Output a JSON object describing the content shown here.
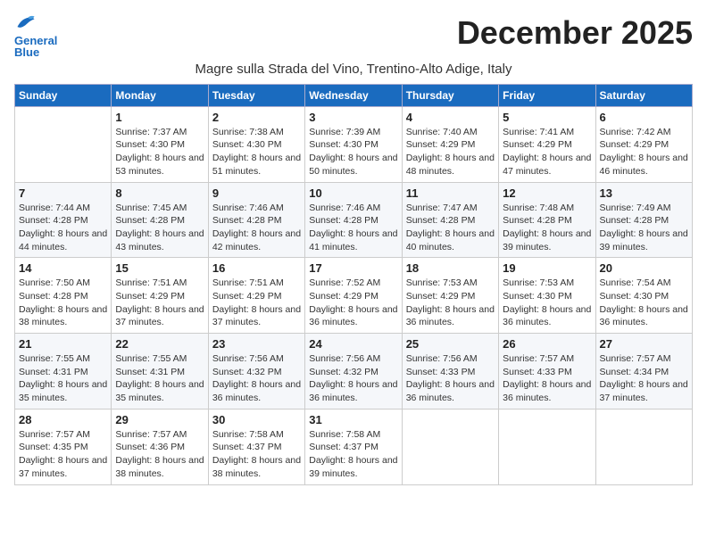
{
  "logo": {
    "line1": "General",
    "line2": "Blue"
  },
  "title": "December 2025",
  "subtitle": "Magre sulla Strada del Vino, Trentino-Alto Adige, Italy",
  "headers": [
    "Sunday",
    "Monday",
    "Tuesday",
    "Wednesday",
    "Thursday",
    "Friday",
    "Saturday"
  ],
  "weeks": [
    [
      {
        "day": "",
        "sunrise": "",
        "sunset": "",
        "daylight": ""
      },
      {
        "day": "1",
        "sunrise": "Sunrise: 7:37 AM",
        "sunset": "Sunset: 4:30 PM",
        "daylight": "Daylight: 8 hours and 53 minutes."
      },
      {
        "day": "2",
        "sunrise": "Sunrise: 7:38 AM",
        "sunset": "Sunset: 4:30 PM",
        "daylight": "Daylight: 8 hours and 51 minutes."
      },
      {
        "day": "3",
        "sunrise": "Sunrise: 7:39 AM",
        "sunset": "Sunset: 4:30 PM",
        "daylight": "Daylight: 8 hours and 50 minutes."
      },
      {
        "day": "4",
        "sunrise": "Sunrise: 7:40 AM",
        "sunset": "Sunset: 4:29 PM",
        "daylight": "Daylight: 8 hours and 48 minutes."
      },
      {
        "day": "5",
        "sunrise": "Sunrise: 7:41 AM",
        "sunset": "Sunset: 4:29 PM",
        "daylight": "Daylight: 8 hours and 47 minutes."
      },
      {
        "day": "6",
        "sunrise": "Sunrise: 7:42 AM",
        "sunset": "Sunset: 4:29 PM",
        "daylight": "Daylight: 8 hours and 46 minutes."
      }
    ],
    [
      {
        "day": "7",
        "sunrise": "Sunrise: 7:44 AM",
        "sunset": "Sunset: 4:28 PM",
        "daylight": "Daylight: 8 hours and 44 minutes."
      },
      {
        "day": "8",
        "sunrise": "Sunrise: 7:45 AM",
        "sunset": "Sunset: 4:28 PM",
        "daylight": "Daylight: 8 hours and 43 minutes."
      },
      {
        "day": "9",
        "sunrise": "Sunrise: 7:46 AM",
        "sunset": "Sunset: 4:28 PM",
        "daylight": "Daylight: 8 hours and 42 minutes."
      },
      {
        "day": "10",
        "sunrise": "Sunrise: 7:46 AM",
        "sunset": "Sunset: 4:28 PM",
        "daylight": "Daylight: 8 hours and 41 minutes."
      },
      {
        "day": "11",
        "sunrise": "Sunrise: 7:47 AM",
        "sunset": "Sunset: 4:28 PM",
        "daylight": "Daylight: 8 hours and 40 minutes."
      },
      {
        "day": "12",
        "sunrise": "Sunrise: 7:48 AM",
        "sunset": "Sunset: 4:28 PM",
        "daylight": "Daylight: 8 hours and 39 minutes."
      },
      {
        "day": "13",
        "sunrise": "Sunrise: 7:49 AM",
        "sunset": "Sunset: 4:28 PM",
        "daylight": "Daylight: 8 hours and 39 minutes."
      }
    ],
    [
      {
        "day": "14",
        "sunrise": "Sunrise: 7:50 AM",
        "sunset": "Sunset: 4:28 PM",
        "daylight": "Daylight: 8 hours and 38 minutes."
      },
      {
        "day": "15",
        "sunrise": "Sunrise: 7:51 AM",
        "sunset": "Sunset: 4:29 PM",
        "daylight": "Daylight: 8 hours and 37 minutes."
      },
      {
        "day": "16",
        "sunrise": "Sunrise: 7:51 AM",
        "sunset": "Sunset: 4:29 PM",
        "daylight": "Daylight: 8 hours and 37 minutes."
      },
      {
        "day": "17",
        "sunrise": "Sunrise: 7:52 AM",
        "sunset": "Sunset: 4:29 PM",
        "daylight": "Daylight: 8 hours and 36 minutes."
      },
      {
        "day": "18",
        "sunrise": "Sunrise: 7:53 AM",
        "sunset": "Sunset: 4:29 PM",
        "daylight": "Daylight: 8 hours and 36 minutes."
      },
      {
        "day": "19",
        "sunrise": "Sunrise: 7:53 AM",
        "sunset": "Sunset: 4:30 PM",
        "daylight": "Daylight: 8 hours and 36 minutes."
      },
      {
        "day": "20",
        "sunrise": "Sunrise: 7:54 AM",
        "sunset": "Sunset: 4:30 PM",
        "daylight": "Daylight: 8 hours and 36 minutes."
      }
    ],
    [
      {
        "day": "21",
        "sunrise": "Sunrise: 7:55 AM",
        "sunset": "Sunset: 4:31 PM",
        "daylight": "Daylight: 8 hours and 35 minutes."
      },
      {
        "day": "22",
        "sunrise": "Sunrise: 7:55 AM",
        "sunset": "Sunset: 4:31 PM",
        "daylight": "Daylight: 8 hours and 35 minutes."
      },
      {
        "day": "23",
        "sunrise": "Sunrise: 7:56 AM",
        "sunset": "Sunset: 4:32 PM",
        "daylight": "Daylight: 8 hours and 36 minutes."
      },
      {
        "day": "24",
        "sunrise": "Sunrise: 7:56 AM",
        "sunset": "Sunset: 4:32 PM",
        "daylight": "Daylight: 8 hours and 36 minutes."
      },
      {
        "day": "25",
        "sunrise": "Sunrise: 7:56 AM",
        "sunset": "Sunset: 4:33 PM",
        "daylight": "Daylight: 8 hours and 36 minutes."
      },
      {
        "day": "26",
        "sunrise": "Sunrise: 7:57 AM",
        "sunset": "Sunset: 4:33 PM",
        "daylight": "Daylight: 8 hours and 36 minutes."
      },
      {
        "day": "27",
        "sunrise": "Sunrise: 7:57 AM",
        "sunset": "Sunset: 4:34 PM",
        "daylight": "Daylight: 8 hours and 37 minutes."
      }
    ],
    [
      {
        "day": "28",
        "sunrise": "Sunrise: 7:57 AM",
        "sunset": "Sunset: 4:35 PM",
        "daylight": "Daylight: 8 hours and 37 minutes."
      },
      {
        "day": "29",
        "sunrise": "Sunrise: 7:57 AM",
        "sunset": "Sunset: 4:36 PM",
        "daylight": "Daylight: 8 hours and 38 minutes."
      },
      {
        "day": "30",
        "sunrise": "Sunrise: 7:58 AM",
        "sunset": "Sunset: 4:37 PM",
        "daylight": "Daylight: 8 hours and 38 minutes."
      },
      {
        "day": "31",
        "sunrise": "Sunrise: 7:58 AM",
        "sunset": "Sunset: 4:37 PM",
        "daylight": "Daylight: 8 hours and 39 minutes."
      },
      {
        "day": "",
        "sunrise": "",
        "sunset": "",
        "daylight": ""
      },
      {
        "day": "",
        "sunrise": "",
        "sunset": "",
        "daylight": ""
      },
      {
        "day": "",
        "sunrise": "",
        "sunset": "",
        "daylight": ""
      }
    ]
  ]
}
